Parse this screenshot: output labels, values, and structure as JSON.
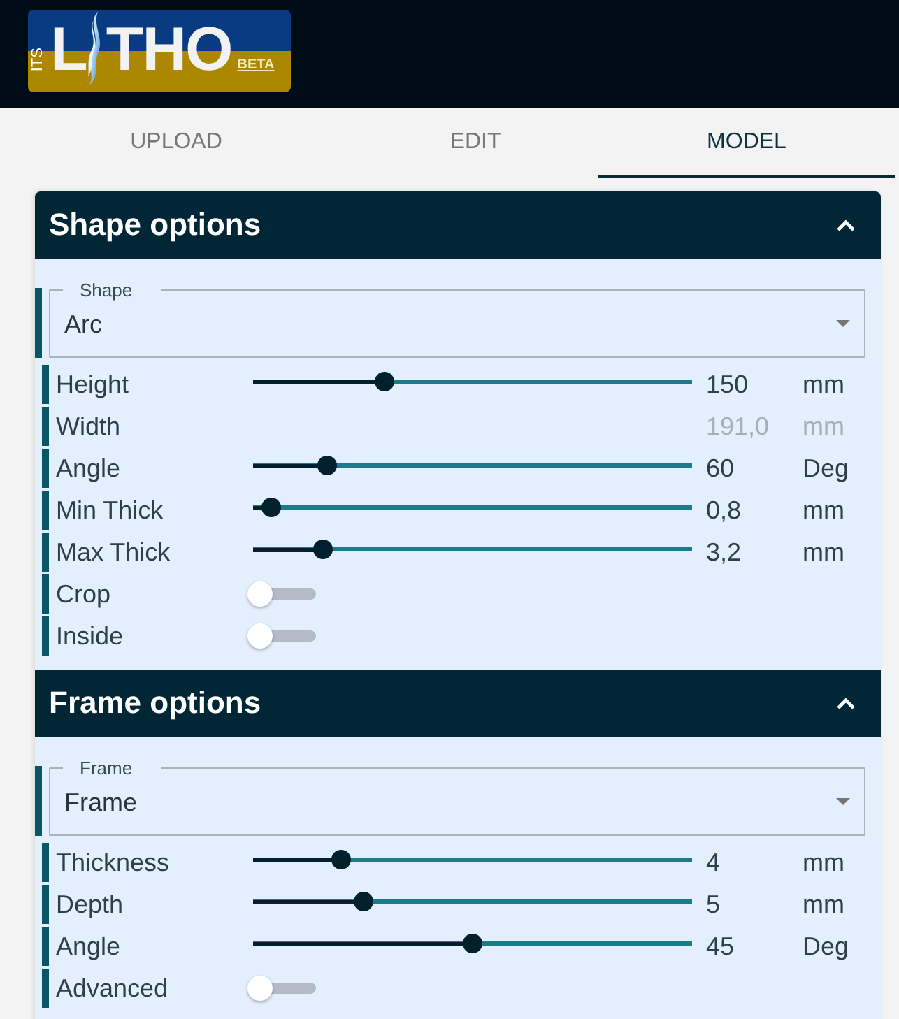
{
  "header": {
    "logo": {
      "vertical_text": "ITS",
      "letter_before_icon": "L",
      "letters_after_icon": "THO",
      "badge": "BETA"
    }
  },
  "tabs": [
    {
      "label": "UPLOAD",
      "selected": false
    },
    {
      "label": "EDIT",
      "selected": false
    },
    {
      "label": "MODEL",
      "selected": true
    }
  ],
  "sections": [
    {
      "title": "Shape options",
      "expanded": true,
      "select": {
        "label": "Shape",
        "value": "Arc"
      },
      "rows": [
        {
          "kind": "slider",
          "label": "Height",
          "level": 0.3,
          "value": "150",
          "unit": "mm",
          "disabled": false
        },
        {
          "kind": "readout",
          "label": "Width",
          "value": "191,0",
          "unit": "mm",
          "disabled": true
        },
        {
          "kind": "slider",
          "label": "Angle",
          "level": 0.17,
          "value": "60",
          "unit": "Deg",
          "disabled": false
        },
        {
          "kind": "slider",
          "label": "Min Thick",
          "level": 0.04,
          "value": "0,8",
          "unit": "mm",
          "disabled": false
        },
        {
          "kind": "slider",
          "label": "Max Thick",
          "level": 0.16,
          "value": "3,2",
          "unit": "mm",
          "disabled": false
        },
        {
          "kind": "toggle",
          "label": "Crop",
          "on": false,
          "disabled": false
        },
        {
          "kind": "toggle",
          "label": "Inside",
          "on": false,
          "disabled": false
        }
      ]
    },
    {
      "title": "Frame options",
      "expanded": true,
      "select": {
        "label": "Frame",
        "value": "Frame"
      },
      "rows": [
        {
          "kind": "slider",
          "label": "Thickness",
          "level": 0.2,
          "value": "4",
          "unit": "mm",
          "disabled": false
        },
        {
          "kind": "slider",
          "label": "Depth",
          "level": 0.25,
          "value": "5",
          "unit": "mm",
          "disabled": false
        },
        {
          "kind": "slider",
          "label": "Angle",
          "level": 0.5,
          "value": "45",
          "unit": "Deg",
          "disabled": false
        },
        {
          "kind": "toggle",
          "label": "Advanced",
          "on": false,
          "disabled": false
        }
      ]
    }
  ]
}
